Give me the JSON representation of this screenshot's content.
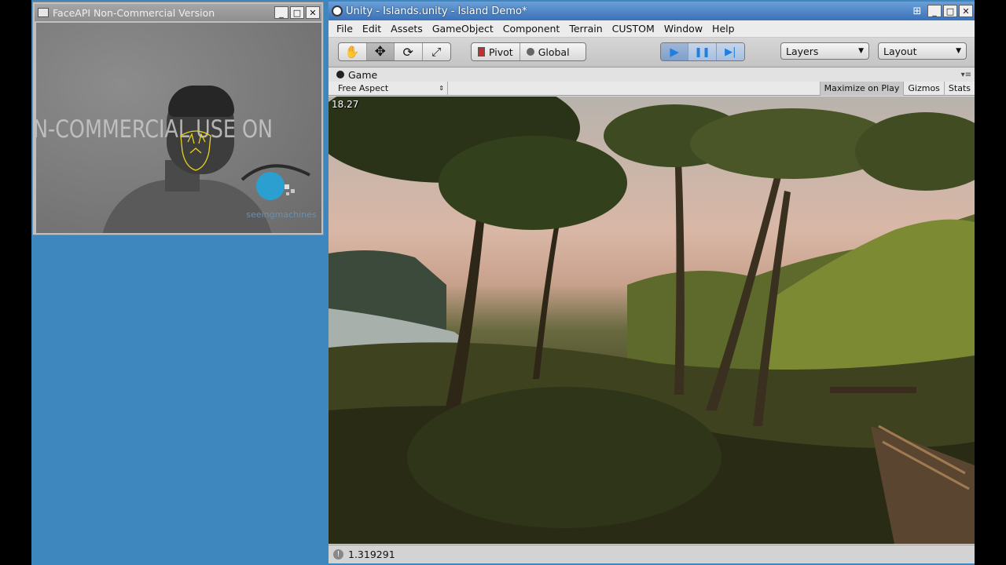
{
  "faceapi": {
    "title": "FaceAPI Non-Commercial Version",
    "watermark": "N-COMMERCIAL USE ON",
    "logo_text": "seeingmachines",
    "buttons": {
      "minimize": "_",
      "maximize": "□",
      "close": "✕"
    }
  },
  "unity": {
    "title": "Unity - Islands.unity - Island Demo*",
    "buttons": {
      "grid": "⊞",
      "minimize": "_",
      "maximize": "□",
      "close": "✕"
    },
    "menu": [
      "File",
      "Edit",
      "Assets",
      "GameObject",
      "Component",
      "Terrain",
      "CUSTOM",
      "Window",
      "Help"
    ],
    "toolbar": {
      "tools": [
        {
          "name": "hand-tool",
          "glyph": "✋"
        },
        {
          "name": "move-tool",
          "glyph": "✥"
        },
        {
          "name": "rotate-tool",
          "glyph": "⟳"
        },
        {
          "name": "scale-tool",
          "glyph": "⤢"
        }
      ],
      "pivot_label": "Pivot",
      "global_label": "Global",
      "play_glyph": "▶",
      "pause_glyph": "❚❚",
      "step_glyph": "▶|",
      "layers_label": "Layers",
      "layout_label": "Layout"
    },
    "game": {
      "tab_label": "Game",
      "aspect_label": "Free Aspect",
      "maximize_on_play": "Maximize on Play",
      "gizmos": "Gizmos",
      "stats": "Stats",
      "fps": "18.27"
    },
    "status_value": "1.319291"
  },
  "colors": {
    "desktop": "#3d86be",
    "unity_title": "#3b72b8"
  }
}
